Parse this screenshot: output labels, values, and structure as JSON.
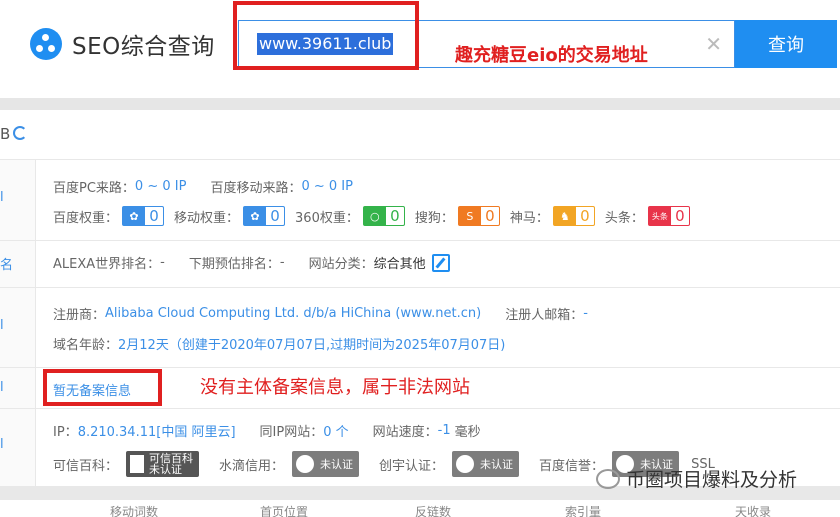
{
  "header": {
    "logo_title": "SEO综合查询",
    "search_value": "www.39611.club",
    "search_button": "查询",
    "annotation_1": "趣充糖豆eio的交易地址"
  },
  "top_row": {
    "label": "B"
  },
  "rows": {
    "left_glyphs": [
      "l",
      "名",
      "l",
      "l",
      "l"
    ],
    "traffic": {
      "pc_label": "百度PC来路：",
      "pc_value": "0 ~ 0 IP",
      "mobile_label": "百度移动来路：",
      "mobile_value": "0 ~ 0 IP"
    },
    "weights": [
      {
        "label": "百度权重：",
        "icon": "paw-icon",
        "value": "0"
      },
      {
        "label": "移动权重：",
        "icon": "paw-icon",
        "value": "0"
      },
      {
        "label": "360权重：",
        "icon": "360-icon",
        "value": "0"
      },
      {
        "label": "搜狗：",
        "icon": "sogou-icon",
        "value": "0"
      },
      {
        "label": "神马：",
        "icon": "shenma-icon",
        "value": "0"
      },
      {
        "label": "头条：",
        "icon": "toutiao-icon",
        "value": "0",
        "icon_text": "头条"
      }
    ],
    "alexa": {
      "alexa_label": "ALEXA世界排名：",
      "alexa_value": "-",
      "next_label": "下期预估排名：",
      "next_value": "-",
      "category_label": "网站分类：",
      "category_value": "综合其他"
    },
    "whois": {
      "registrar_label": "注册商：",
      "registrar_value": "Alibaba Cloud Computing Ltd. d/b/a HiChina (www.net.cn)",
      "email_label": "注册人邮箱：",
      "email_value": "-",
      "age_label": "域名年龄：",
      "age_value": "2月12天（创建于2020年07月07日,过期时间为2025年07月07日)"
    },
    "beian": {
      "value": "暂无备案信息",
      "annotation_2": "没有主体备案信息，属于非法网站"
    },
    "server": {
      "ip_label": "IP：",
      "ip_value": "8.210.34.11[中国 阿里云]",
      "same_ip_label": "同IP网站：",
      "same_ip_value": "0 个",
      "speed_label": "网站速度：",
      "speed_value": "-1",
      "speed_unit": "毫秒"
    },
    "credit": {
      "kexin_label": "可信百科：",
      "kexin_cert_line1": "可信百科",
      "kexin_cert_line2": "未认证",
      "shuidi_label": "水滴信用：",
      "shuidi_cert": "未认证",
      "chuangyu_label": "创宇认证：",
      "chuangyu_cert": "未认证",
      "baidu_label": "百度信誉：",
      "baidu_cert": "未认证",
      "ssl_label": "SSL"
    }
  },
  "bottom_headers": [
    "移动词数",
    "首页位置",
    "反链数",
    "索引量",
    "天收录"
  ],
  "watermark": "币圈项目爆料及分析",
  "colors": {
    "accent": "#1f8ef1",
    "annotation": "#e02020"
  }
}
